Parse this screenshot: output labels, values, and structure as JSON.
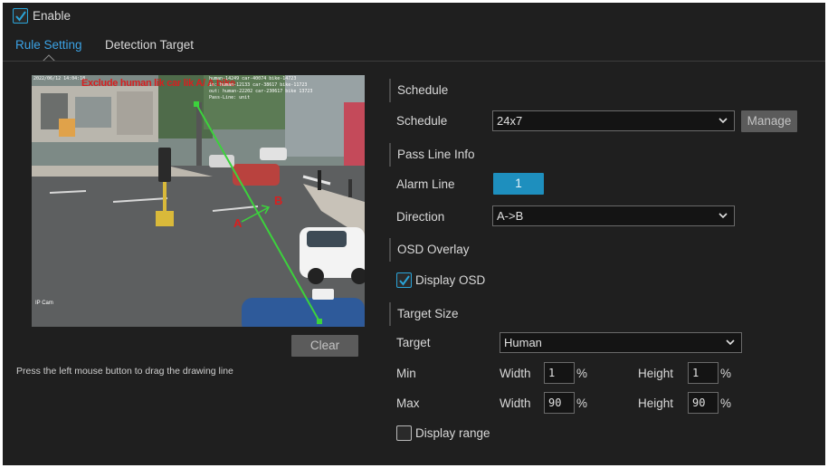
{
  "enable": {
    "label": "Enable",
    "checked": true
  },
  "tabs": [
    {
      "label": "Rule Setting",
      "active": true
    },
    {
      "label": "Detection Target",
      "active": false
    }
  ],
  "video": {
    "timestamp": "2022/06/12 14:04:18",
    "overlay_title": "Exclude human lik car lik A/ A bike",
    "overlay_stats_1": "human-14249 car-40074 bike-14723",
    "overlay_stats_2": "in: human-12133 car-38617 bike-11723",
    "overlay_stats_3": "out: human-22202 car-230617 bike 13723",
    "overlay_stats_4": "Pass-Line: unit",
    "camera_label": "IP Cam",
    "line_label_a": "A",
    "line_label_b": "B"
  },
  "clear_button": "Clear",
  "hint_text": "Press the left mouse button to drag the drawing line",
  "schedule": {
    "section_title": "Schedule",
    "label": "Schedule",
    "value": "24x7",
    "manage_button": "Manage"
  },
  "pass_line": {
    "section_title": "Pass Line Info",
    "alarm_line_label": "Alarm Line",
    "alarm_line_value": "1",
    "direction_label": "Direction",
    "direction_value": "A->B"
  },
  "osd": {
    "section_title": "OSD Overlay",
    "display_osd_label": "Display OSD",
    "display_osd_checked": true
  },
  "target_size": {
    "section_title": "Target Size",
    "target_label": "Target",
    "target_value": "Human",
    "min_label": "Min",
    "max_label": "Max",
    "width_label": "Width",
    "height_label": "Height",
    "min_width": "1",
    "min_height": "1",
    "max_width": "90",
    "max_height": "90",
    "unit": "%",
    "display_range_label": "Display range",
    "display_range_checked": false
  },
  "colors": {
    "accent": "#3ba3e6",
    "alarm_button": "#1e8fbe",
    "background": "#1f1f1f",
    "detection_line": "#3cd23c"
  }
}
